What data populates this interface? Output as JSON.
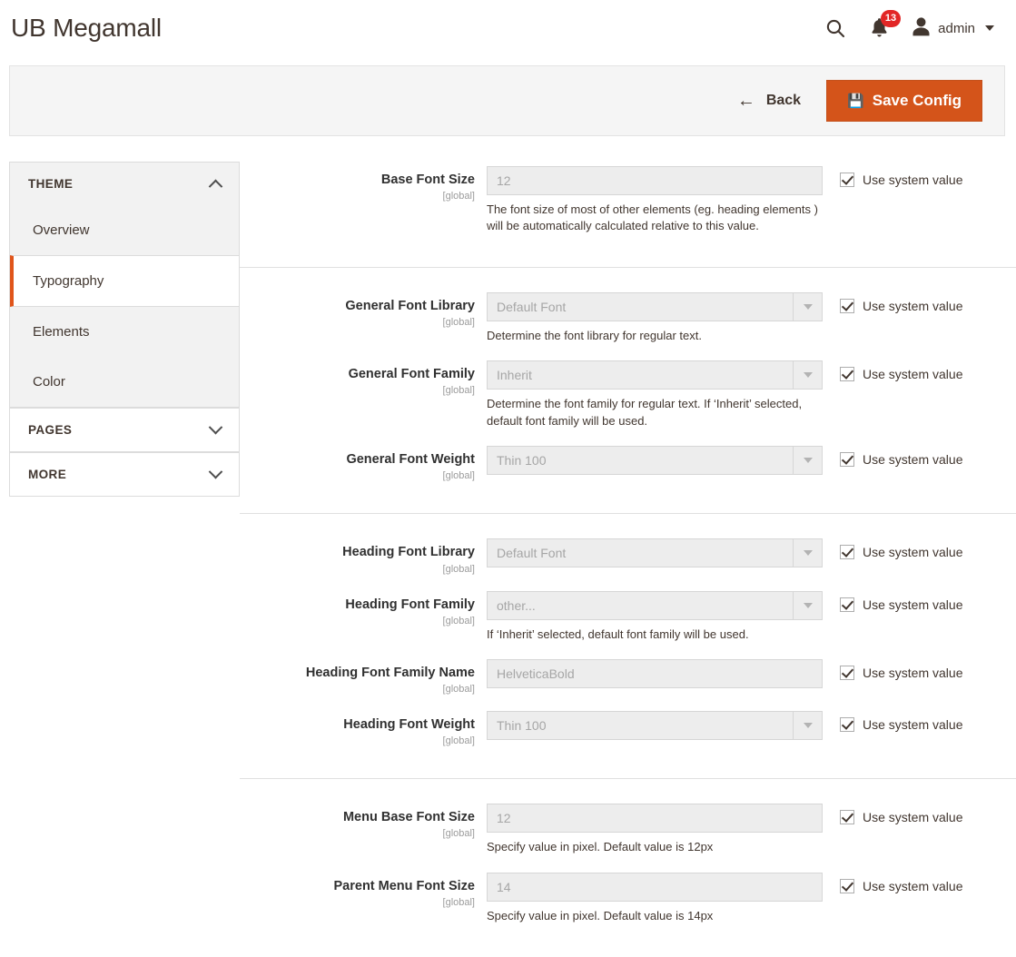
{
  "header": {
    "title": "UB Megamall",
    "search_icon": "search-icon",
    "notifications_icon": "bell-icon",
    "notifications_count": "13",
    "user_icon": "user-avatar-icon",
    "user_name": "admin",
    "user_caret_icon": "chevron-down-icon"
  },
  "toolbar": {
    "back_label": "Back",
    "back_icon": "arrow-left-icon",
    "save_label": "Save Config",
    "save_icon": "save-floppy-icon",
    "save_color": "#d4541a"
  },
  "sidebar": {
    "sections": [
      {
        "label": "THEME",
        "expanded": true,
        "chevron": "chevron-up-icon",
        "items": [
          {
            "label": "Overview",
            "active": false
          },
          {
            "label": "Typography",
            "active": true
          },
          {
            "label": "Elements",
            "active": false
          },
          {
            "label": "Color",
            "active": false
          }
        ]
      },
      {
        "label": "PAGES",
        "expanded": false,
        "chevron": "chevron-down-icon",
        "items": []
      },
      {
        "label": "MORE",
        "expanded": false,
        "chevron": "chevron-down-icon",
        "items": []
      }
    ],
    "active_accent_color": "#e0551b"
  },
  "form": {
    "scope_label": "[global]",
    "system_value_label": "Use system value",
    "groups": [
      {
        "fields": [
          {
            "label": "Base Font Size",
            "scope": "[global]",
            "type": "text",
            "value": "12",
            "note": "The font size of most of other elements (eg. heading elements ) will be automatically calculated relative to this value.",
            "use_system_value": true
          }
        ]
      },
      {
        "fields": [
          {
            "label": "General Font Library",
            "scope": "[global]",
            "type": "select",
            "value": "Default Font",
            "note": "Determine the font library for regular text.",
            "use_system_value": true
          },
          {
            "label": "General Font Family",
            "scope": "[global]",
            "type": "select",
            "value": "Inherit",
            "note": "Determine the font family for regular text. If ‘Inherit’ selected, default font family will be used.",
            "use_system_value": true
          },
          {
            "label": "General Font Weight",
            "scope": "[global]",
            "type": "select",
            "value": "Thin 100",
            "note": "",
            "use_system_value": true
          }
        ]
      },
      {
        "fields": [
          {
            "label": "Heading Font Library",
            "scope": "[global]",
            "type": "select",
            "value": "Default Font",
            "note": "",
            "use_system_value": true
          },
          {
            "label": "Heading Font Family",
            "scope": "[global]",
            "type": "select",
            "value": "other...",
            "note": "If ‘Inherit’ selected, default font family will be used.",
            "use_system_value": true
          },
          {
            "label": "Heading Font Family Name",
            "scope": "[global]",
            "type": "text",
            "value": "HelveticaBold",
            "note": "",
            "use_system_value": true
          },
          {
            "label": "Heading Font Weight",
            "scope": "[global]",
            "type": "select",
            "value": "Thin 100",
            "note": "",
            "use_system_value": true
          }
        ]
      },
      {
        "fields": [
          {
            "label": "Menu Base Font Size",
            "scope": "[global]",
            "type": "text",
            "value": "12",
            "note": "Specify value in pixel. Default value is 12px",
            "use_system_value": true
          },
          {
            "label": "Parent Menu Font Size",
            "scope": "[global]",
            "type": "text",
            "value": "14",
            "note": "Specify value in pixel. Default value is 14px",
            "use_system_value": true
          }
        ]
      }
    ]
  }
}
